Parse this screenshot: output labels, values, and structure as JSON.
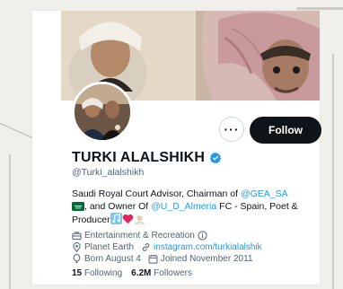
{
  "profile": {
    "name": "TURKI ALALSHIKH",
    "handle": "@Turki_alalshikh",
    "bio": {
      "line1_text": "Saudi Royal Court Advisor, Chairman of ",
      "line1_link": "@GEA_SA",
      "line2_text": ", and Owner Of ",
      "line2_link": "@U_D_Almeria",
      "line2_rest": " FC - Spain, Poet &",
      "line3_text": "Producer"
    },
    "category": "Entertainment & Recreation",
    "location": "Planet Earth",
    "website": "instagram.com/turkialalshik",
    "born": "Born August 4",
    "joined": "Joined November 2011",
    "following_count": "15",
    "following_label": "Following",
    "followers_count": "6.2M",
    "followers_label": "Followers"
  },
  "actions": {
    "more_label": "···",
    "follow_label": "Follow"
  },
  "colors": {
    "accent": "#1d9bf0",
    "text": "#0f1419",
    "secondary": "#536471"
  },
  "icons": [
    "verified-badge-icon",
    "flag-icon",
    "music-notes-icon",
    "heart-icon",
    "person-icon",
    "briefcase-icon",
    "info-icon",
    "location-pin-icon",
    "link-icon",
    "balloon-icon",
    "calendar-icon"
  ]
}
